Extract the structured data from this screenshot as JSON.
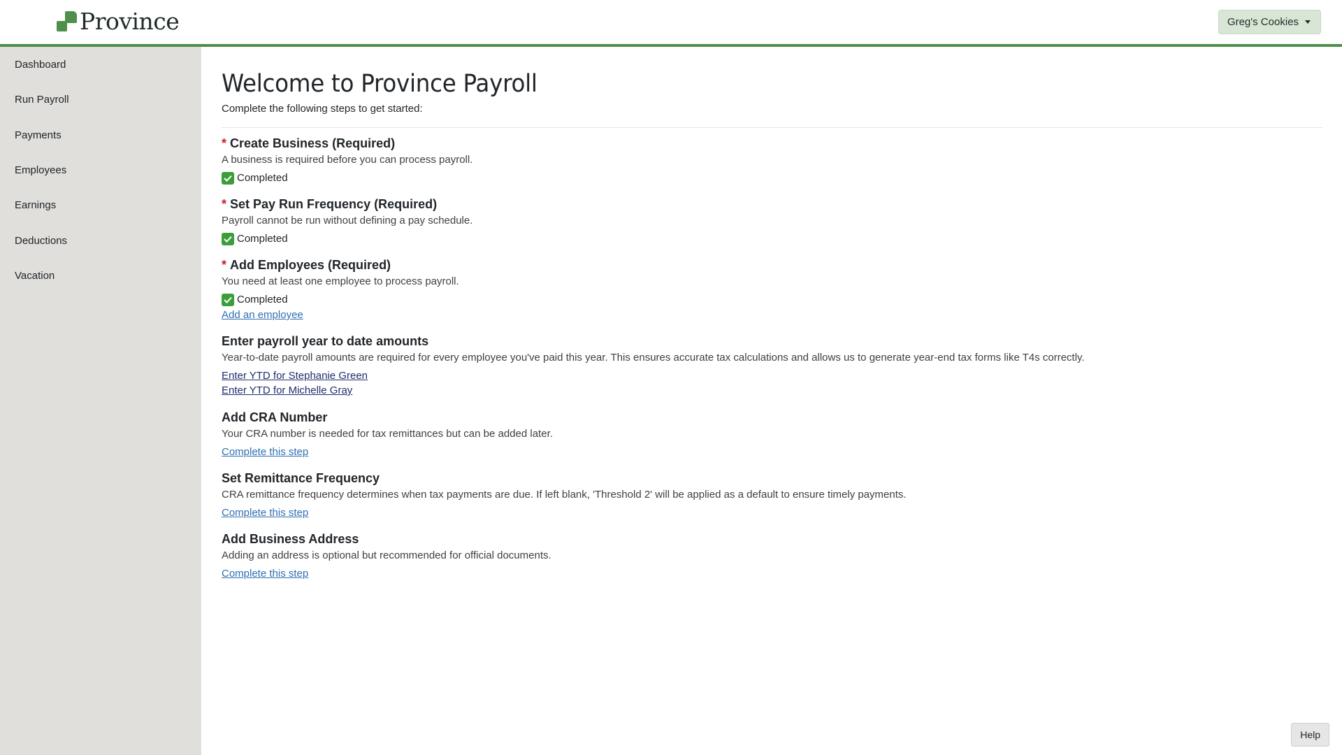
{
  "header": {
    "logo_text": "Province",
    "account_label": "Greg's Cookies",
    "accent_color": "#4e8f4a"
  },
  "sidebar": {
    "items": [
      {
        "label": "Dashboard"
      },
      {
        "label": "Run Payroll"
      },
      {
        "label": "Payments"
      },
      {
        "label": "Employees"
      },
      {
        "label": "Earnings"
      },
      {
        "label": "Deductions"
      },
      {
        "label": "Vacation"
      }
    ]
  },
  "main": {
    "title": "Welcome to Province Payroll",
    "subtitle": "Complete the following steps to get started:",
    "steps": [
      {
        "required_marker": "*",
        "title": "Create Business (Required)",
        "description": "A business is required before you can process payroll.",
        "status": "Completed"
      },
      {
        "required_marker": "*",
        "title": "Set Pay Run Frequency (Required)",
        "description": "Payroll cannot be run without defining a pay schedule.",
        "status": "Completed"
      },
      {
        "required_marker": "*",
        "title": "Add Employees (Required)",
        "description": "You need at least one employee to process payroll.",
        "status": "Completed",
        "link": "Add an employee"
      },
      {
        "title": "Enter payroll year to date amounts",
        "description": "Year-to-date payroll amounts are required for every employee you've paid this year. This ensures accurate tax calculations and allows us to generate year-end tax forms like T4s correctly.",
        "links": [
          "Enter YTD for Stephanie Green",
          "Enter YTD for Michelle Gray"
        ]
      },
      {
        "title": "Add CRA Number",
        "description": "Your CRA number is needed for tax remittances but can be added later.",
        "link": "Complete this step"
      },
      {
        "title": "Set Remittance Frequency",
        "description": "CRA remittance frequency determines when tax payments are due. If left blank, 'Threshold 2' will be applied as a default to ensure timely payments.",
        "link": "Complete this step"
      },
      {
        "title": "Add Business Address",
        "description": "Adding an address is optional but recommended for official documents.",
        "link": "Complete this step"
      }
    ]
  },
  "help_label": "Help"
}
